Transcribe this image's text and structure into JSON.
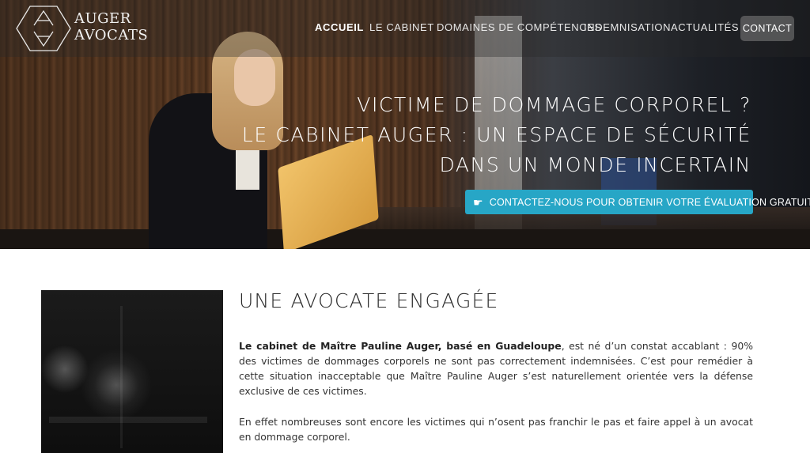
{
  "brand": {
    "line1": "AUGER",
    "line2": "AVOCATS"
  },
  "nav": {
    "items": [
      {
        "label": "ACCUEIL",
        "active": true
      },
      {
        "label": "LE CABINET",
        "active": false
      },
      {
        "label": "DOMAINES DE COMPÉTENCES",
        "active": false
      },
      {
        "label": "INDEMNISATION",
        "active": false
      },
      {
        "label": "ACTUALITÉS",
        "active": false
      }
    ],
    "contact_label": "CONTACT"
  },
  "hero": {
    "headline": [
      "VICTIME DE DOMMAGE CORPOREL ?",
      "LE CABINET AUGER : UN ESPACE DE SÉCURITÉ",
      "DANS UN MONDE INCERTAIN"
    ],
    "cta_icon": "pointing-hand-icon",
    "cta_label": "CONTACTEZ-NOUS POUR OBTENIR VOTRE ÉVALUATION GRATUITE"
  },
  "content": {
    "title": "UNE AVOCATE ENGAGÉE",
    "p1_bold": "Le cabinet de Maître Pauline Auger, basé en Guadeloupe",
    "p1_rest": ", est né d’un constat accablant : 90% des victimes de dommages corporels ne sont pas correctement indemnisées. C’est pour remédier à cette situation inacceptable que Maître Pauline Auger s’est naturellement orientée vers la défense exclusive de ces victimes.",
    "p2": "En effet nombreuses sont encore les victimes qui n’osent pas franchir le pas et faire appel à un avocat en dommage corporel."
  },
  "colors": {
    "accent": "#27a6c6",
    "nav_text": "#e8e8e8"
  }
}
